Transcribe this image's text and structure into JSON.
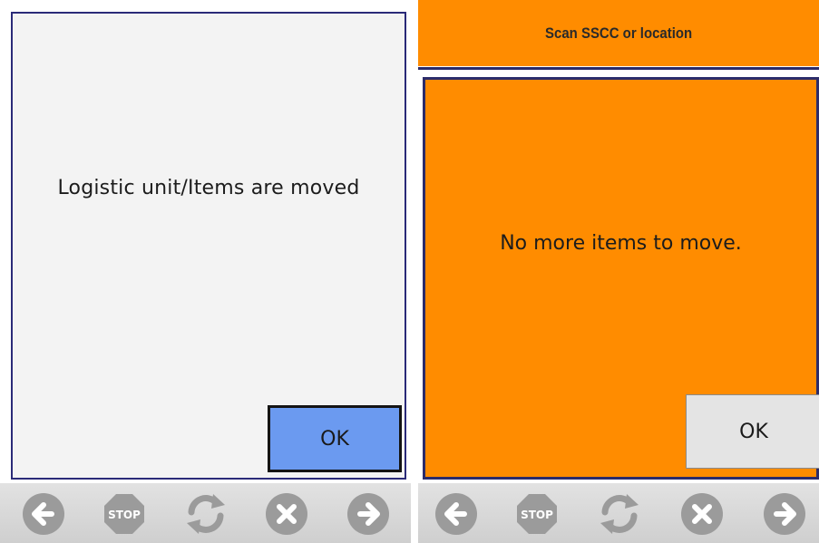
{
  "left_screen": {
    "message": "Logistic unit/Items are moved",
    "ok_label": "OK"
  },
  "right_screen": {
    "title": "Scan SSCC or location",
    "message": "No more items to move.",
    "ok_label": "OK"
  },
  "toolbar": {
    "buttons": [
      {
        "icon": "back-arrow-icon"
      },
      {
        "icon": "stop-icon",
        "label": "STOP"
      },
      {
        "icon": "refresh-icon"
      },
      {
        "icon": "cancel-icon"
      },
      {
        "icon": "forward-arrow-icon"
      }
    ]
  },
  "colors": {
    "dialog_border": "#2a2a78",
    "left_background": "#f3f3f3",
    "ok_active": "#6b9af0",
    "orange": "#ff8c00",
    "toolbar_icon": "#9b9b9b"
  }
}
